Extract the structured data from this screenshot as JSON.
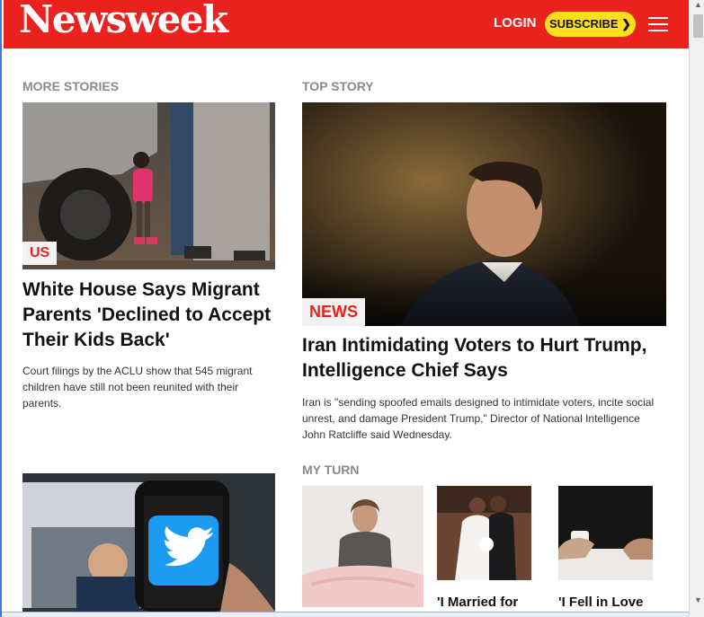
{
  "header": {
    "logo": "Newsweek",
    "login_label": "LOGIN",
    "subscribe_label": "SUBSCRIBE ❯"
  },
  "more_stories": {
    "label": "MORE STORIES",
    "story1": {
      "tag": "US",
      "headline": "White House Says Migrant Parents 'Declined to Accept Their Kids Back'",
      "summary": "Court filings by the ACLU show that 545 migrant children have still not been reunited with their parents."
    }
  },
  "top_story": {
    "label": "TOP STORY",
    "tag": "NEWS",
    "headline": "Iran Intimidating Voters to Hurt Trump, Intelligence Chief Says",
    "summary": "Iran is \"sending spoofed emails designed to intimidate voters, incite social unrest, and damage President Trump,\" Director of National Intelligence John Ratcliffe said Wednesday."
  },
  "my_turn": {
    "label": "MY TURN",
    "items": [
      {
        "caption": ""
      },
      {
        "caption": "'I Married for"
      },
      {
        "caption": "'I Fell in Love"
      }
    ]
  }
}
